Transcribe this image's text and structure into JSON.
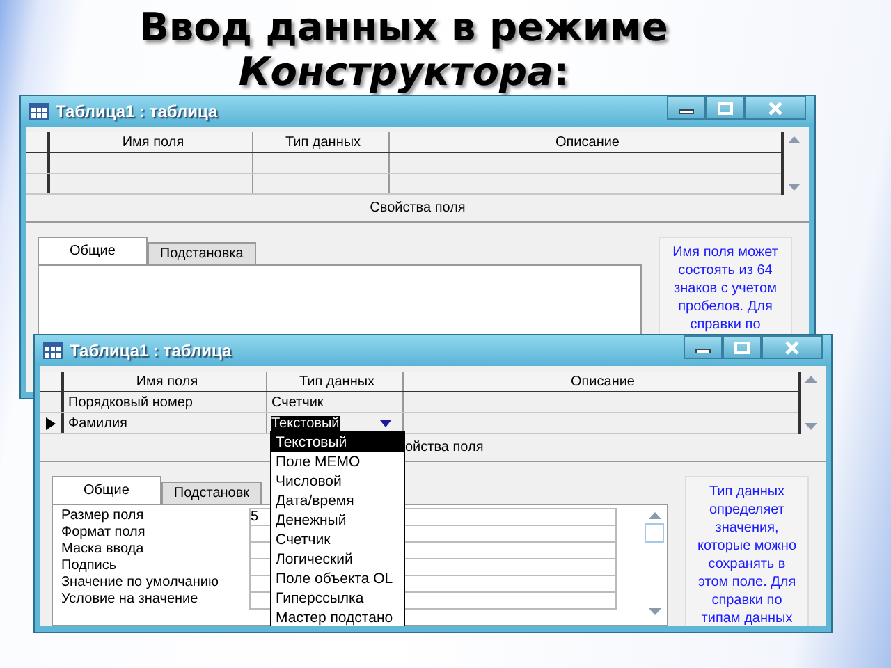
{
  "slide": {
    "title": [
      "Ввод данных в режиме",
      "*Конструктора*:"
    ]
  },
  "windows": [
    {
      "title": "Таблица1 : таблица",
      "columns": [
        "Имя поля",
        "Тип данных",
        "Описание"
      ],
      "rows": [
        {
          "current": false
        },
        {
          "current": false
        }
      ],
      "properties_caption": "Свойства поля",
      "tabs": [
        {
          "label": "Общие",
          "selected": true
        },
        {
          "label": "Подстановка",
          "selected": false
        }
      ],
      "help": "Имя поля может состоять из 64 знаков с учетом пробелов.  Для справки по"
    },
    {
      "title": "Таблица1 : таблица",
      "columns": [
        "Имя поля",
        "Тип данных",
        "Описание"
      ],
      "rows": [
        {
          "field_name": "Порядковый номер",
          "data_type": "Счетчик",
          "current": false
        },
        {
          "field_name": "Фамилия",
          "data_type": "Текстовый",
          "current": true
        }
      ],
      "properties_caption": "ойства поля",
      "tabs": [
        {
          "label": "Общие",
          "selected": true
        },
        {
          "label": "Подстановк",
          "selected": false
        }
      ],
      "properties": [
        {
          "label": "Размер поля",
          "value": "5"
        },
        {
          "label": "Формат поля"
        },
        {
          "label": "Маска ввода"
        },
        {
          "label": "Подпись"
        },
        {
          "label": "Значение по умолчанию"
        },
        {
          "label": "Условие на значение"
        }
      ],
      "help": "Тип данных определяет значения, которые можно сохранять в этом поле.  Для справки по типам данных",
      "dropdown": {
        "items": [
          {
            "label": "Текстовый",
            "selected": true
          },
          {
            "label": "Поле MEMO",
            "selected": false
          },
          {
            "label": "Числовой",
            "selected": false
          },
          {
            "label": "Дата/время",
            "selected": false
          },
          {
            "label": "Денежный",
            "selected": false
          },
          {
            "label": "Счетчик",
            "selected": false
          },
          {
            "label": "Логический",
            "selected": false
          },
          {
            "label": "Поле объекта OL",
            "selected": false
          },
          {
            "label": "Гиперссылка",
            "selected": false
          },
          {
            "label": "Мастер подстано",
            "selected": false
          }
        ]
      }
    }
  ]
}
